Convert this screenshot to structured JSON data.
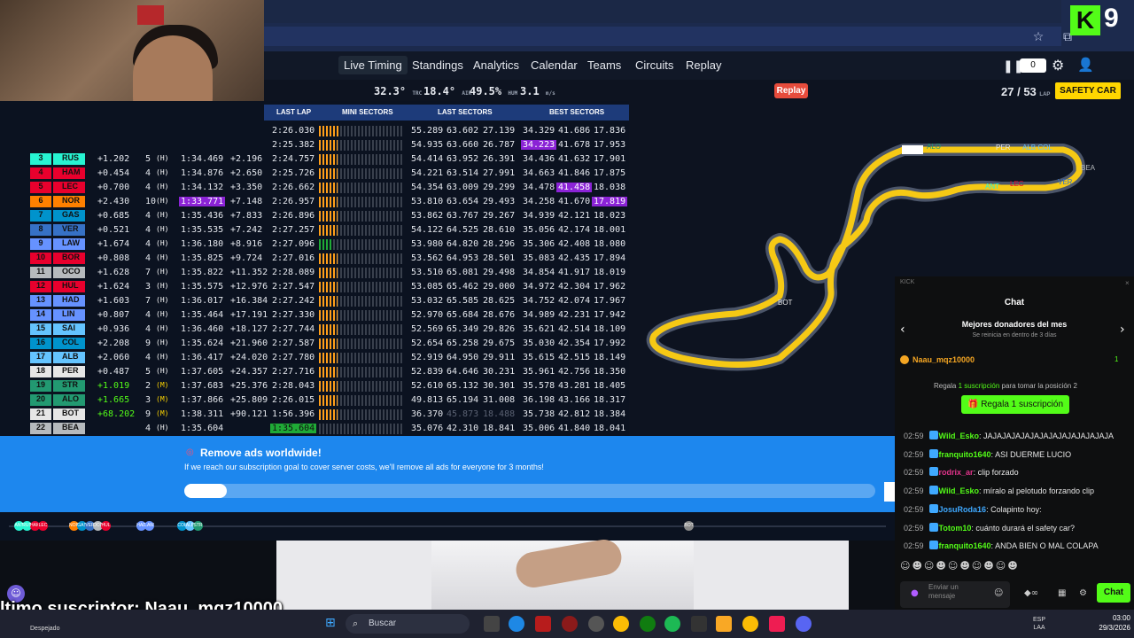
{
  "browser": {
    "logo_text": "K",
    "logo_number": "9",
    "bookmark_icon": "star-icon",
    "extension_icon": "puzzle-icon"
  },
  "nav": {
    "items": [
      "Live Timing",
      "Standings",
      "Analytics",
      "Calendar",
      "Teams",
      "Circuits",
      "Replay"
    ],
    "active": "Live Timing",
    "pause_icon": "pause-icon",
    "delay_value": "0",
    "settings_icon": "gear-icon",
    "user_icon": "user-icon"
  },
  "weather": {
    "track_temp": "32.3°",
    "track_label": "TRC",
    "air_temp": "18.4°",
    "air_label": "AIR",
    "humidity": "49.5%",
    "humidity_label": "HUM",
    "wind": "3.1",
    "wind_label": "m/s"
  },
  "session": {
    "replay_label": "Replay",
    "lap_current": "27",
    "lap_total": "53",
    "lap_label": "LAP",
    "status": "SAFETY CAR"
  },
  "table": {
    "headers": [
      "LAST LAP",
      "MINI SECTORS",
      "LAST SECTORS",
      "BEST SECTORS"
    ],
    "rows": [
      {
        "pos": "",
        "abbr": "",
        "gap": "",
        "laps": "",
        "tyre": "",
        "best": "",
        "delta": "",
        "last": "2:26.030",
        "mini": 0.25,
        "ls": [
          "55.289",
          "63.602",
          "27.139"
        ],
        "bs": [
          "34.329",
          "41.686",
          "17.836"
        ],
        "color": "#3671c6"
      },
      {
        "pos": "",
        "abbr": "",
        "gap": "",
        "laps": "",
        "tyre": "",
        "best": "",
        "delta": "",
        "last": "2:25.382",
        "mini": 0.22,
        "ls": [
          "54.935",
          "63.660",
          "26.787"
        ],
        "bs": [
          "34.223",
          "41.678",
          "17.953"
        ],
        "color": "#27f4d2"
      },
      {
        "pos": "3",
        "abbr": "RUS",
        "gap": "+1.202",
        "laps": "5",
        "tyre": "H",
        "best": "1:34.469",
        "delta": "+2.196",
        "last": "2:24.757",
        "mini": 0.22,
        "ls": [
          "54.414",
          "63.952",
          "26.391"
        ],
        "bs": [
          "34.436",
          "41.632",
          "17.901"
        ],
        "color": "#27f4d2"
      },
      {
        "pos": "4",
        "abbr": "HAM",
        "gap": "+0.454",
        "laps": "4",
        "tyre": "H",
        "best": "1:34.876",
        "delta": "+2.650",
        "last": "2:25.726",
        "mini": 0.22,
        "ls": [
          "54.221",
          "63.514",
          "27.991"
        ],
        "bs": [
          "34.663",
          "41.846",
          "17.875"
        ],
        "color": "#e8002d"
      },
      {
        "pos": "5",
        "abbr": "LEC",
        "gap": "+0.700",
        "laps": "4",
        "tyre": "H",
        "best": "1:34.132",
        "delta": "+3.350",
        "last": "2:26.662",
        "mini": 0.22,
        "ls": [
          "54.354",
          "63.009",
          "29.299"
        ],
        "bs": [
          "34.478",
          "41.458",
          "18.038"
        ],
        "color": "#e8002d"
      },
      {
        "pos": "6",
        "abbr": "NOR",
        "gap": "+2.430",
        "laps": "10",
        "tyre": "H",
        "best": "1:33.771",
        "delta": "+7.148",
        "last": "2:26.957",
        "mini": 0.22,
        "ls": [
          "53.810",
          "63.654",
          "29.493"
        ],
        "bs": [
          "34.258",
          "41.670",
          "17.819"
        ],
        "color": "#ff8000"
      },
      {
        "pos": "7",
        "abbr": "GAS",
        "gap": "+0.685",
        "laps": "4",
        "tyre": "H",
        "best": "1:35.436",
        "delta": "+7.833",
        "last": "2:26.896",
        "mini": 0.22,
        "ls": [
          "53.862",
          "63.767",
          "29.267"
        ],
        "bs": [
          "34.939",
          "42.121",
          "18.023"
        ],
        "color": "#0093cc"
      },
      {
        "pos": "8",
        "abbr": "VER",
        "gap": "+0.521",
        "laps": "4",
        "tyre": "H",
        "best": "1:35.535",
        "delta": "+7.242",
        "last": "2:27.257",
        "mini": 0.22,
        "ls": [
          "54.122",
          "64.525",
          "28.610"
        ],
        "bs": [
          "35.056",
          "42.174",
          "18.001"
        ],
        "color": "#3671c6"
      },
      {
        "pos": "9",
        "abbr": "LAW",
        "gap": "+1.674",
        "laps": "4",
        "tyre": "H",
        "best": "1:36.180",
        "delta": "+8.916",
        "last": "2:27.096",
        "mini": 0.16,
        "ls": [
          "53.980",
          "64.820",
          "28.296"
        ],
        "bs": [
          "35.306",
          "42.408",
          "18.080"
        ],
        "color": "#6692ff"
      },
      {
        "pos": "10",
        "abbr": "BOR",
        "gap": "+0.808",
        "laps": "4",
        "tyre": "H",
        "best": "1:35.825",
        "delta": "+9.724",
        "last": "2:27.016",
        "mini": 0.22,
        "ls": [
          "53.562",
          "64.953",
          "28.501"
        ],
        "bs": [
          "35.083",
          "42.435",
          "17.894"
        ],
        "color": "#e8002d"
      },
      {
        "pos": "11",
        "abbr": "OCO",
        "gap": "+1.628",
        "laps": "7",
        "tyre": "H",
        "best": "1:35.822",
        "delta": "+11.352",
        "last": "2:28.089",
        "mini": 0.22,
        "ls": [
          "53.510",
          "65.081",
          "29.498"
        ],
        "bs": [
          "34.854",
          "41.917",
          "18.019"
        ],
        "color": "#b6babd"
      },
      {
        "pos": "12",
        "abbr": "HUL",
        "gap": "+1.624",
        "laps": "3",
        "tyre": "H",
        "best": "1:35.575",
        "delta": "+12.976",
        "last": "2:27.547",
        "mini": 0.22,
        "ls": [
          "53.085",
          "65.462",
          "29.000"
        ],
        "bs": [
          "34.972",
          "42.304",
          "17.962"
        ],
        "color": "#e8002d"
      },
      {
        "pos": "13",
        "abbr": "HAD",
        "gap": "+1.603",
        "laps": "7",
        "tyre": "H",
        "best": "1:36.017",
        "delta": "+16.384",
        "last": "2:27.242",
        "mini": 0.22,
        "ls": [
          "53.032",
          "65.585",
          "28.625"
        ],
        "bs": [
          "34.752",
          "42.074",
          "17.967"
        ],
        "color": "#6692ff"
      },
      {
        "pos": "14",
        "abbr": "LIN",
        "gap": "+0.807",
        "laps": "4",
        "tyre": "H",
        "best": "1:35.464",
        "delta": "+17.191",
        "last": "2:27.330",
        "mini": 0.22,
        "ls": [
          "52.970",
          "65.684",
          "28.676"
        ],
        "bs": [
          "34.989",
          "42.231",
          "17.942"
        ],
        "color": "#6692ff"
      },
      {
        "pos": "15",
        "abbr": "SAI",
        "gap": "+0.936",
        "laps": "4",
        "tyre": "H",
        "best": "1:36.460",
        "delta": "+18.127",
        "last": "2:27.744",
        "mini": 0.22,
        "ls": [
          "52.569",
          "65.349",
          "29.826"
        ],
        "bs": [
          "35.621",
          "42.514",
          "18.109"
        ],
        "color": "#64c4ff"
      },
      {
        "pos": "16",
        "abbr": "COL",
        "gap": "+2.208",
        "laps": "9",
        "tyre": "H",
        "best": "1:35.624",
        "delta": "+21.960",
        "last": "2:27.587",
        "mini": 0.22,
        "ls": [
          "52.654",
          "65.258",
          "29.675"
        ],
        "bs": [
          "35.030",
          "42.354",
          "17.992"
        ],
        "color": "#0093cc"
      },
      {
        "pos": "17",
        "abbr": "ALB",
        "gap": "+2.060",
        "laps": "4",
        "tyre": "H",
        "best": "1:36.417",
        "delta": "+24.020",
        "last": "2:27.780",
        "mini": 0.22,
        "ls": [
          "52.919",
          "64.950",
          "29.911"
        ],
        "bs": [
          "35.615",
          "42.515",
          "18.149"
        ],
        "color": "#64c4ff"
      },
      {
        "pos": "18",
        "abbr": "PER",
        "gap": "+0.487",
        "laps": "5",
        "tyre": "H",
        "best": "1:37.605",
        "delta": "+24.357",
        "last": "2:27.716",
        "mini": 0.22,
        "ls": [
          "52.839",
          "64.646",
          "30.231"
        ],
        "bs": [
          "35.961",
          "42.756",
          "18.350"
        ],
        "color": "#e6e6e6"
      },
      {
        "pos": "19",
        "abbr": "STR",
        "gap": "+1.019",
        "laps": "2",
        "tyre": "M",
        "best": "1:37.683",
        "delta": "+25.376",
        "last": "2:28.043",
        "mini": 0.22,
        "ls": [
          "52.610",
          "65.132",
          "30.301"
        ],
        "bs": [
          "35.578",
          "43.281",
          "18.405"
        ],
        "color": "#229971"
      },
      {
        "pos": "20",
        "abbr": "ALO",
        "gap": "+1.665",
        "laps": "3",
        "tyre": "M",
        "best": "1:37.866",
        "delta": "+25.809",
        "last": "2:26.015",
        "mini": 0.22,
        "ls": [
          "49.813",
          "65.194",
          "31.008"
        ],
        "bs": [
          "36.198",
          "43.166",
          "18.317"
        ],
        "color": "#229971"
      },
      {
        "pos": "21",
        "abbr": "BOT",
        "gap": "+68.202",
        "laps": "9",
        "tyre": "M",
        "best": "1:38.311",
        "delta": "+90.121",
        "last": "1:56.396",
        "mini": 0.22,
        "ls": [
          "36.370",
          "45.873",
          "18.488"
        ],
        "bs": [
          "35.738",
          "42.812",
          "18.384"
        ],
        "color": "#e6e6e6"
      },
      {
        "pos": "22",
        "abbr": "BEA",
        "gap": "",
        "laps": "4",
        "tyre": "H",
        "best": "1:35.604",
        "delta": "",
        "last": "1:35.604",
        "mini": 0.0,
        "ls": [
          "35.076",
          "42.310",
          "18.841"
        ],
        "bs": [
          "35.006",
          "41.840",
          "18.041"
        ],
        "color": "#b6babd"
      }
    ]
  },
  "track": {
    "labels": [
      "ALO",
      "PER",
      "ALB COL",
      "BEA",
      "VER",
      "ANT",
      "LEC",
      "BOT"
    ]
  },
  "banner": {
    "title": "Remove ads worldwide!",
    "text": "If we reach our subscription goal to cover server costs, we'll remove all ads for everyone for 3 months!",
    "progress": 0.06
  },
  "timeline": {
    "dots": [
      {
        "label": "ANT",
        "color": "#27f4d2"
      },
      {
        "label": "RUS",
        "color": "#27f4d2"
      },
      {
        "label": "HAM",
        "color": "#e8002d"
      },
      {
        "label": "LEC",
        "color": "#e8002d"
      },
      {
        "label": "NOR",
        "color": "#ff8000"
      },
      {
        "label": "GAS",
        "color": "#0093cc"
      },
      {
        "label": "VER",
        "color": "#3671c6"
      },
      {
        "label": "OCO",
        "color": "#b6babd"
      },
      {
        "label": "HUL",
        "color": "#e8002d"
      },
      {
        "label": "HAD",
        "color": "#6692ff"
      },
      {
        "label": "LAW",
        "color": "#6692ff"
      },
      {
        "label": "COL",
        "color": "#0093cc"
      },
      {
        "label": "ALB",
        "color": "#64c4ff"
      },
      {
        "label": "STR",
        "color": "#229971"
      },
      {
        "label": "BOT",
        "color": "#888888"
      }
    ]
  },
  "overlay": {
    "subscriber": "ltimo suscriptor: Naau_mqz10000"
  },
  "chat": {
    "platform": "KICK",
    "title": "Chat",
    "donors_title": "Mejores donadores del mes",
    "donors_sub": "Se reinicia en dentro de 3 días",
    "top_donor": "Naau_mqz10000",
    "top_donor_count": "1",
    "gift_prompt_pre": "Regala",
    "gift_prompt_link": "1 suscripción",
    "gift_prompt_post": "para tomar la posición 2",
    "gift_button": "Regala 1 suscripción",
    "messages": [
      {
        "time": "02:59",
        "user": "Wild_Esko",
        "color": "#53fc18",
        "text": "JAJAJAJAJAJAJAJAJAJAJAJAJAJA"
      },
      {
        "time": "02:59",
        "user": "franquito1640",
        "color": "#53fc18",
        "text": "ASI DUERME LUCIO"
      },
      {
        "time": "02:59",
        "user": "rodrix_ar",
        "color": "#e0338a",
        "text": "clip forzado"
      },
      {
        "time": "02:59",
        "user": "Wild_Esko",
        "color": "#53fc18",
        "text": "míralo al pelotudo forzando clip"
      },
      {
        "time": "02:59",
        "user": "JosuRoda16",
        "color": "#3fa9ff",
        "text": "Colapinto hoy:"
      },
      {
        "time": "02:59",
        "user": "Totom10",
        "color": "#53fc18",
        "text": "cuánto durará el safety car?"
      },
      {
        "time": "02:59",
        "user": "franquito1640",
        "color": "#53fc18",
        "text": "ANDA BIEN O MAL COLAPA"
      }
    ],
    "input_placeholder": "Enviar un mensaje",
    "send_label": "Chat"
  },
  "taskbar": {
    "weather": "Despejado",
    "search_placeholder": "Buscar",
    "lang": "ESP",
    "lang_sub": "LAA",
    "time": "03:00",
    "date": "29/3/2026"
  }
}
